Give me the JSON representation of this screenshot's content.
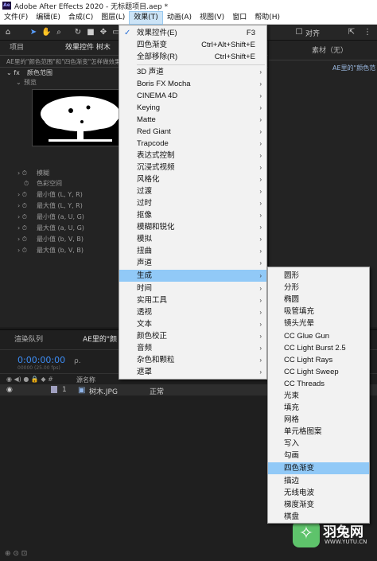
{
  "window": {
    "title": "Adobe After Effects 2020 - 无标题项目.aep *",
    "logo": "Ae"
  },
  "menubar": [
    "文件(F)",
    "编辑(E)",
    "合成(C)",
    "图层(L)",
    "效果(T)",
    "动画(A)",
    "视图(V)",
    "窗口",
    "帮助(H)"
  ],
  "toolbar": {
    "snap_label": "对齐"
  },
  "left_panel": {
    "tab_project": "项目",
    "tab_effects": "效果控件 树木",
    "comp_info": "AE里的\"颜色范围\"和\"四色渐变\"怎样做效果 • 树木.JPG",
    "effect_name": "颜色范围",
    "preview_label": "预览",
    "props": [
      "模糊",
      "色彩空间",
      "最小值 (L, Y, R)",
      "最大值 (L, Y, R)",
      "最小值 (a, U, G)",
      "最大值 (a, U, G)",
      "最小值 (b, V, B)",
      "最大值 (b, V, B)"
    ]
  },
  "right_panel": {
    "title": "素材（无）",
    "item": "AE里的\"颜色范"
  },
  "timeline": {
    "tab_render": "渲染队列",
    "tab_comp": "AE里的\"颜",
    "timecode": "0:00:00:00",
    "timecode_sub": "00000 (25.00 fps)",
    "search_placeholder": "ρ.",
    "col_source": "源名称",
    "layer_number": "1",
    "layer_name": "树木.JPG",
    "mode": "正常",
    "watermark_text": "羽兔网",
    "watermark_url": "WWW.YUTU.CN"
  },
  "effects_menu": {
    "items": [
      {
        "label": "效果控件(E)",
        "shortcut": "F3",
        "checked": true
      },
      {
        "label": "四色渐变",
        "shortcut": "Ctrl+Alt+Shift+E"
      },
      {
        "label": "全部移除(R)",
        "shortcut": "Ctrl+Shift+E"
      },
      {
        "label": "3D 声道",
        "submenu": true
      },
      {
        "label": "Boris FX Mocha",
        "submenu": true
      },
      {
        "label": "CINEMA 4D",
        "submenu": true
      },
      {
        "label": "Keying",
        "submenu": true
      },
      {
        "label": "Matte",
        "submenu": true
      },
      {
        "label": "Red Giant",
        "submenu": true
      },
      {
        "label": "Trapcode",
        "submenu": true
      },
      {
        "label": "表达式控制",
        "submenu": true
      },
      {
        "label": "沉浸式视频",
        "submenu": true
      },
      {
        "label": "风格化",
        "submenu": true
      },
      {
        "label": "过渡",
        "submenu": true
      },
      {
        "label": "过时",
        "submenu": true
      },
      {
        "label": "抠像",
        "submenu": true
      },
      {
        "label": "模糊和锐化",
        "submenu": true
      },
      {
        "label": "模拟",
        "submenu": true
      },
      {
        "label": "扭曲",
        "submenu": true
      },
      {
        "label": "声道",
        "submenu": true
      },
      {
        "label": "生成",
        "submenu": true,
        "highlighted": true
      },
      {
        "label": "时间",
        "submenu": true
      },
      {
        "label": "实用工具",
        "submenu": true
      },
      {
        "label": "透视",
        "submenu": true
      },
      {
        "label": "文本",
        "submenu": true
      },
      {
        "label": "颜色校正",
        "submenu": true
      },
      {
        "label": "音频",
        "submenu": true
      },
      {
        "label": "杂色和颗粒",
        "submenu": true
      },
      {
        "label": "遮罩",
        "submenu": true
      }
    ]
  },
  "generate_submenu": {
    "items": [
      "圆形",
      "分形",
      "椭圆",
      "吸管填充",
      "镜头光晕",
      "CC Glue Gun",
      "CC Light Burst 2.5",
      "CC Light Rays",
      "CC Light Sweep",
      "CC Threads",
      "光束",
      "填充",
      "网格",
      "单元格图案",
      "写入",
      "勾画",
      "四色渐变",
      "描边",
      "无线电波",
      "梯度渐变",
      "棋盘"
    ],
    "highlighted": "四色渐变"
  }
}
